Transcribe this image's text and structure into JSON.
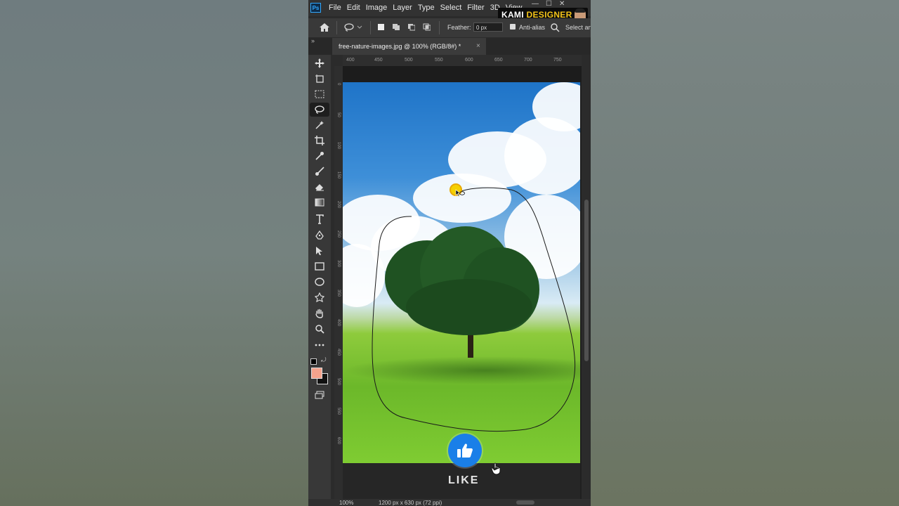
{
  "menu": {
    "items": [
      "File",
      "Edit",
      "Image",
      "Layer",
      "Type",
      "Select",
      "Filter",
      "3D",
      "View"
    ],
    "ps_logo": "Ps"
  },
  "brand": {
    "kami": "KAMI ",
    "designer": "DESIGNER"
  },
  "options": {
    "feather_label": "Feather:",
    "feather_value": "0 px",
    "antialias_label": "Anti-alias",
    "select_label": "Select an"
  },
  "tab": {
    "title": "free-nature-images.jpg @ 100% (RGB/8#) *",
    "close": "×",
    "collapse": "»"
  },
  "ruler": {
    "h_ticks": [
      "400",
      "450",
      "500",
      "550",
      "600",
      "650",
      "700",
      "750"
    ],
    "v_ticks": [
      "0",
      "50",
      "100",
      "150",
      "200",
      "250",
      "300",
      "350",
      "400",
      "450",
      "500",
      "550",
      "600"
    ]
  },
  "overlay": {
    "like": "LIKE"
  },
  "status": {
    "zoom": "100%",
    "dims": "1200 px x 630 px (72 ppi)"
  },
  "colors": {
    "foreground": "#f4a38d",
    "background": "#111111",
    "accent": "#1a7fe8"
  }
}
